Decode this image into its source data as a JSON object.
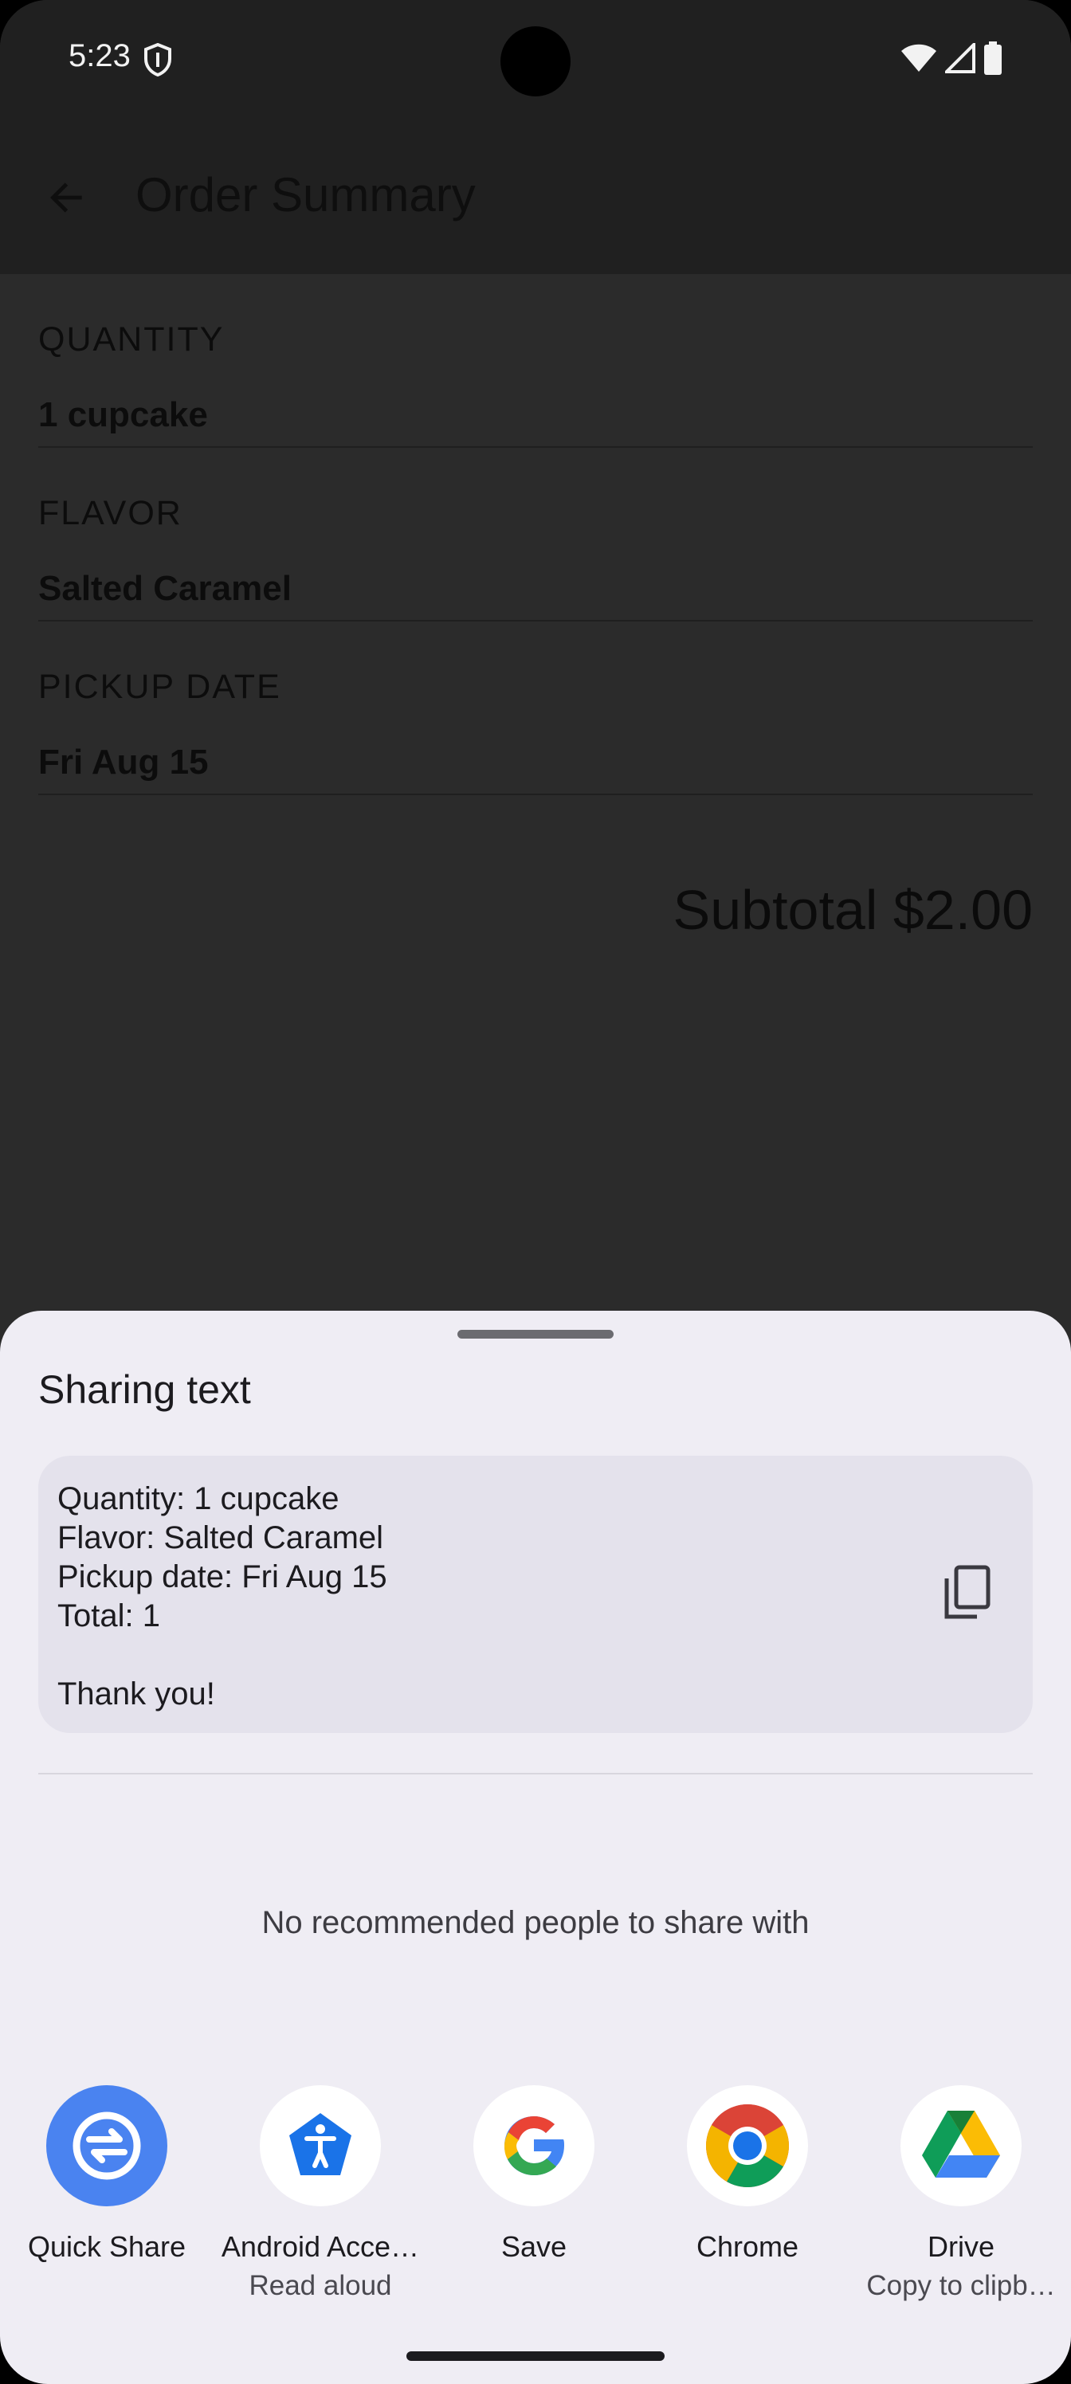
{
  "status_bar": {
    "time": "5:23"
  },
  "app_bar": {
    "title": "Order Summary"
  },
  "order": {
    "sections": [
      {
        "label": "QUANTITY",
        "value": "1 cupcake"
      },
      {
        "label": "FLAVOR",
        "value": "Salted Caramel"
      },
      {
        "label": "PICKUP DATE",
        "value": "Fri Aug 15"
      }
    ],
    "subtotal": "Subtotal $2.00"
  },
  "share_sheet": {
    "title": "Sharing text",
    "preview_text": "Quantity: 1 cupcake\nFlavor: Salted Caramel\nPickup date: Fri Aug 15\nTotal: 1\n\nThank you!",
    "no_recommend": "No recommended people to share with",
    "targets": [
      {
        "label": "Quick Share",
        "sublabel": "",
        "icon": "quick-share-icon",
        "color": "#4a83f0"
      },
      {
        "label": "Android Acce…",
        "sublabel": "Read aloud",
        "icon": "accessibility-icon",
        "color": "#1a73e8"
      },
      {
        "label": "Save",
        "sublabel": "",
        "icon": "google-icon",
        "color": "#ffffff"
      },
      {
        "label": "Chrome",
        "sublabel": "",
        "icon": "chrome-icon",
        "color": "#ffffff"
      },
      {
        "label": "Drive",
        "sublabel": "Copy to clipb…",
        "icon": "drive-icon",
        "color": "#ffffff"
      }
    ]
  }
}
